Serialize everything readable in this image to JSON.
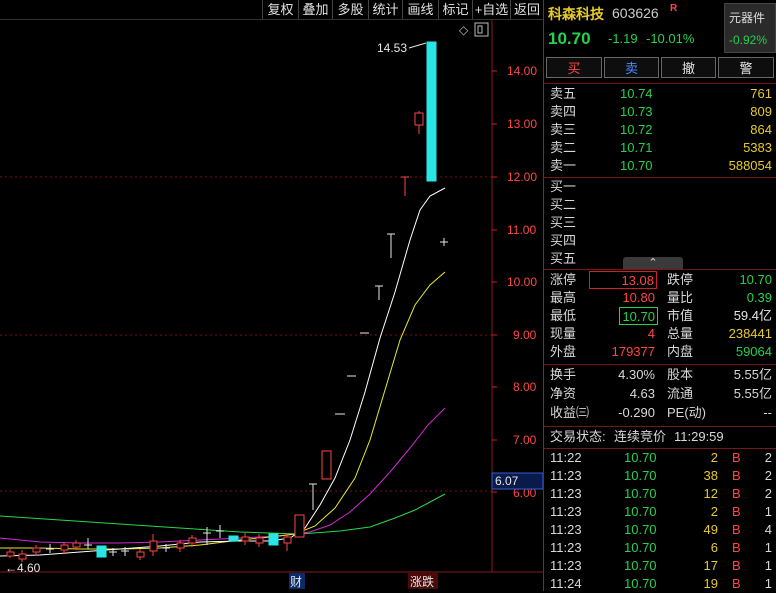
{
  "toolbar": [
    "复权",
    "叠加",
    "多股",
    "统计",
    "画线",
    "标记",
    "+自选",
    "返回"
  ],
  "chart": {
    "y_ticks": [
      "14.00",
      "13.00",
      "12.00",
      "11.00",
      "10.00",
      "9.00",
      "8.00",
      "7.00",
      "6.00"
    ],
    "high_label": "14.53",
    "low_label": "←4.60",
    "current_tag": "6.07",
    "markers": {
      "cai": "财",
      "zhangdie": "涨跌"
    }
  },
  "quote": {
    "name": "科森科技",
    "code": "603626",
    "tag": "R",
    "sector": "元器件",
    "sector_change": "-0.92%",
    "price": "10.70",
    "change": "-1.19",
    "change_pct": "-10.01%"
  },
  "trade_buttons": [
    "买",
    "卖",
    "撤",
    "警"
  ],
  "asks": [
    {
      "label": "卖五",
      "price": "10.74",
      "vol": "761"
    },
    {
      "label": "卖四",
      "price": "10.73",
      "vol": "809"
    },
    {
      "label": "卖三",
      "price": "10.72",
      "vol": "864"
    },
    {
      "label": "卖二",
      "price": "10.71",
      "vol": "5383"
    },
    {
      "label": "卖一",
      "price": "10.70",
      "vol": "588054"
    }
  ],
  "bids": [
    {
      "label": "买一",
      "price": "",
      "vol": ""
    },
    {
      "label": "买二",
      "price": "",
      "vol": ""
    },
    {
      "label": "买三",
      "price": "",
      "vol": ""
    },
    {
      "label": "买四",
      "price": "",
      "vol": ""
    },
    {
      "label": "买五",
      "price": "",
      "vol": ""
    }
  ],
  "stats": [
    {
      "l1": "涨停",
      "v1": "13.08",
      "l2": "跌停",
      "v2": "10.70"
    },
    {
      "l1": "最高",
      "v1": "10.80",
      "l2": "量比",
      "v2": "0.39"
    },
    {
      "l1": "最低",
      "v1": "10.70",
      "l2": "市值",
      "v2": "59.4亿"
    },
    {
      "l1": "现量",
      "v1": "4",
      "l2": "总量",
      "v2": "238441"
    },
    {
      "l1": "外盘",
      "v1": "179377",
      "l2": "内盘",
      "v2": "59064"
    }
  ],
  "stats2": [
    {
      "l1": "换手",
      "v1": "4.30%",
      "l2": "股本",
      "v2": "5.55亿"
    },
    {
      "l1": "净资",
      "v1": "4.63",
      "l2": "流通",
      "v2": "5.55亿"
    },
    {
      "l1": "收益㈢",
      "v1": "-0.290",
      "l2": "PE(动)",
      "v2": "--"
    }
  ],
  "trade_status": {
    "label": "交易状态:",
    "value": "连续竞价",
    "time": "11:29:59"
  },
  "ticks": [
    {
      "time": "11:22",
      "price": "10.70",
      "vol": "2",
      "side": "B",
      "count": "2"
    },
    {
      "time": "11:23",
      "price": "10.70",
      "vol": "38",
      "side": "B",
      "count": "2"
    },
    {
      "time": "11:23",
      "price": "10.70",
      "vol": "12",
      "side": "B",
      "count": "2"
    },
    {
      "time": "11:23",
      "price": "10.70",
      "vol": "2",
      "side": "B",
      "count": "1"
    },
    {
      "time": "11:23",
      "price": "10.70",
      "vol": "49",
      "side": "B",
      "count": "4"
    },
    {
      "time": "11:23",
      "price": "10.70",
      "vol": "6",
      "side": "B",
      "count": "1"
    },
    {
      "time": "11:23",
      "price": "10.70",
      "vol": "17",
      "side": "B",
      "count": "1"
    },
    {
      "time": "11:24",
      "price": "10.70",
      "vol": "19",
      "side": "B",
      "count": "1"
    }
  ]
}
